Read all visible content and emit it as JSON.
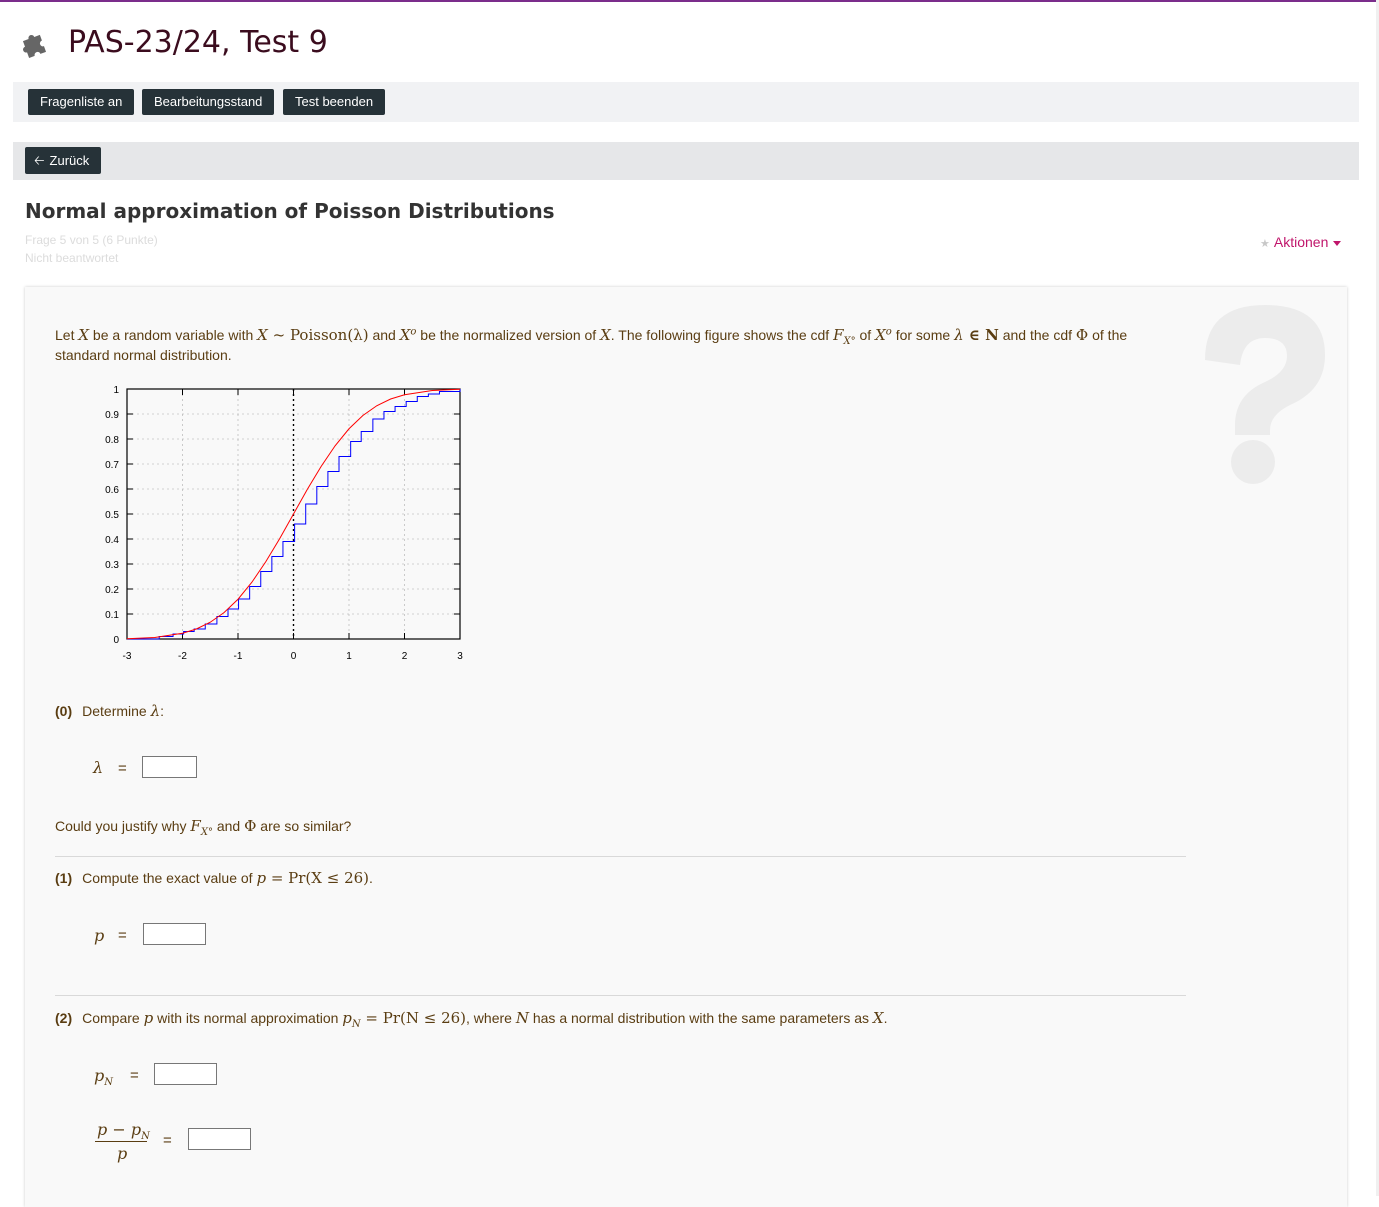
{
  "header": {
    "title": "PAS-23/24, Test 9",
    "buttons": [
      "Fragenliste an",
      "Bearbeitungsstand",
      "Test beenden"
    ],
    "back_label": "Zurück"
  },
  "question": {
    "title": "Normal approximation of Poisson Distributions",
    "meta_position": "Frage 5 von 5 (6 Punkte)",
    "meta_status": "Nicht beantwortet",
    "actions_label": "Aktionen"
  },
  "intro": {
    "t1": "Let ",
    "m1": "X",
    "t2": " be a random variable with ",
    "m2": "X ~ ",
    "m2b": "Poisson(λ)",
    "t3": " and ",
    "m3": "X",
    "m3sup": "o",
    "t4": " be the normalized version of ",
    "m4": "X",
    "t5": ". The following figure shows the cdf ",
    "m5": "F",
    "m5sub": "X°",
    "t6": " of ",
    "m6": "X",
    "m6sup": "o",
    "t7": " for some ",
    "m7": "λ",
    "m7b": " ∈ N",
    "t8": " and the cdf ",
    "m8": "Φ",
    "t9": " of the",
    "line2": "standard normal distribution."
  },
  "part0": {
    "num": "(0)",
    "text": "Determine ",
    "math": "λ",
    "colon": ":",
    "var": "λ",
    "eq": "=",
    "value": ""
  },
  "justify": {
    "t1": "Could you justify why ",
    "m1": "F",
    "m1sub": "X°",
    "t2": " and ",
    "m2": "Φ",
    "t3": " are so similar?"
  },
  "part1": {
    "num": "(1)",
    "text": "Compute the exact value of ",
    "math": "p = ",
    "mathb": "Pr(X ≤ 26)",
    "dot": ".",
    "var": "p",
    "eq": "=",
    "value": ""
  },
  "part2": {
    "num": "(2)",
    "t1": "Compare ",
    "m1": "p",
    "t2": " with its normal approximation ",
    "m2": "p",
    "m2sub": "N",
    "m2b": " = Pr(N ≤ 26)",
    "t3": ", where ",
    "m3": "N",
    "t4": " has a normal distribution with the same parameters as ",
    "m4": "X",
    "dot": ".",
    "var1": "p",
    "var1sub": "N",
    "eq1": "=",
    "frac_num": "p − p",
    "frac_num_sub": "N",
    "frac_den": "p",
    "eq2": "="
  },
  "chart_data": {
    "type": "line",
    "title": "",
    "xlabel": "",
    "ylabel": "",
    "xlim": [
      -3,
      3
    ],
    "ylim": [
      0,
      1
    ],
    "xticks": [
      "-3",
      "-2",
      "-1",
      "0",
      "1",
      "2",
      "3"
    ],
    "yticks": [
      "0",
      "0.1",
      "0.2",
      "0.3",
      "0.4",
      "0.5",
      "0.6",
      "0.7",
      "0.8",
      "0.9",
      "1"
    ],
    "grid": true,
    "series": [
      {
        "kind": "step",
        "color": "#0000ff",
        "x": [
          -3.0,
          -2.42,
          -2.17,
          -1.98,
          -1.79,
          -1.59,
          -1.38,
          -1.18,
          -0.99,
          -0.79,
          -0.59,
          -0.39,
          -0.19,
          0.02,
          0.22,
          0.42,
          0.62,
          0.82,
          1.03,
          1.22,
          1.43,
          1.63,
          1.83,
          2.03,
          2.23,
          2.43,
          2.63,
          2.83,
          3.0
        ],
        "y": [
          0.0,
          0.01,
          0.02,
          0.03,
          0.04,
          0.06,
          0.09,
          0.12,
          0.16,
          0.21,
          0.27,
          0.33,
          0.39,
          0.46,
          0.54,
          0.61,
          0.67,
          0.73,
          0.79,
          0.83,
          0.88,
          0.91,
          0.93,
          0.95,
          0.97,
          0.98,
          0.99,
          0.99,
          1.0
        ]
      },
      {
        "kind": "curve",
        "color": "#ff0000",
        "x": [
          -3.0,
          -2.5,
          -2.0,
          -1.75,
          -1.5,
          -1.25,
          -1.0,
          -0.75,
          -0.5,
          -0.25,
          0.0,
          0.25,
          0.5,
          0.75,
          1.0,
          1.25,
          1.5,
          1.75,
          2.0,
          2.5,
          3.0
        ],
        "y": [
          0.001,
          0.006,
          0.023,
          0.04,
          0.067,
          0.106,
          0.159,
          0.227,
          0.309,
          0.401,
          0.5,
          0.599,
          0.691,
          0.773,
          0.841,
          0.894,
          0.933,
          0.96,
          0.977,
          0.994,
          0.999
        ]
      }
    ],
    "vline_x": 0
  }
}
